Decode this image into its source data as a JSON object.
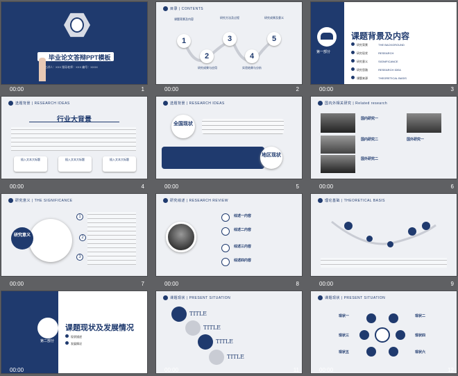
{
  "slides": [
    {
      "num": "1",
      "time": "00:00",
      "title": "毕业论文答辩PPT模板",
      "meta": "主讲人：XXX  指导老师：XXX  编号：XXXX"
    },
    {
      "num": "2",
      "time": "00:00",
      "header": "目录 | CONTENTS",
      "items": [
        "1",
        "2",
        "3",
        "4",
        "5"
      ],
      "labels": [
        "课题背景及内容",
        "研究成果与应用",
        "研究方法及过程",
        "实验结果与分析",
        "研究成果及意义"
      ]
    },
    {
      "num": "3",
      "time": "00:00",
      "title": "课题背景及内容",
      "part": "第一部分",
      "list": [
        "研究背景",
        "研究现状",
        "研究意义",
        "研究思路",
        "课题来源"
      ],
      "en": [
        "THE BACKGROUND",
        "RESEARCH",
        "SIGNIFICANCE",
        "RESEARCH IDEA",
        "THEORETICAL BASIS"
      ]
    },
    {
      "num": "4",
      "time": "00:00",
      "header": "选题背景 | RESEARCH IDEAS",
      "title": "行业大背景",
      "cards": [
        "插入文本大标题",
        "插入文本大标题",
        "插入文本大标题"
      ]
    },
    {
      "num": "5",
      "time": "00:00",
      "header": "选题背景 | RESEARCH IDEAS",
      "national": "全国现状",
      "regional": "地区现状"
    },
    {
      "num": "6",
      "time": "00:00",
      "header": "国内外相关研究 | Related research",
      "items": [
        "国内研究一",
        "国内研究二",
        "国外研究一",
        "国外研究二"
      ]
    },
    {
      "num": "7",
      "time": "00:00",
      "header": "研究意义 | THE SIGNIFICANCE",
      "center": "研究意义",
      "nums": [
        "1",
        "2",
        "3"
      ]
    },
    {
      "num": "8",
      "time": "00:00",
      "header": "研究综述 | RESEARCH REVIEW",
      "items": [
        "综述一内容",
        "综述二内容",
        "综述三内容",
        "综述四内容"
      ]
    },
    {
      "num": "9",
      "time": "00:00",
      "header": "理论基础 | THEORETICAL BASIS"
    },
    {
      "num": "10",
      "time": "00:00",
      "title": "课题现状及发展情况",
      "part": "第二部分",
      "list": [
        "现状描述",
        "发展情况"
      ]
    },
    {
      "num": "11",
      "time": "00:00",
      "header": "课题现状 | PRESENT SITUATION",
      "titles": [
        "TITLE",
        "TITLE",
        "TITLE",
        "TITLE"
      ]
    },
    {
      "num": "12",
      "time": "00:00",
      "header": "课题现状 | PRESENT SITUATION",
      "items": [
        "现状一",
        "现状二",
        "现状三",
        "现状四",
        "现状五",
        "现状六"
      ]
    }
  ]
}
